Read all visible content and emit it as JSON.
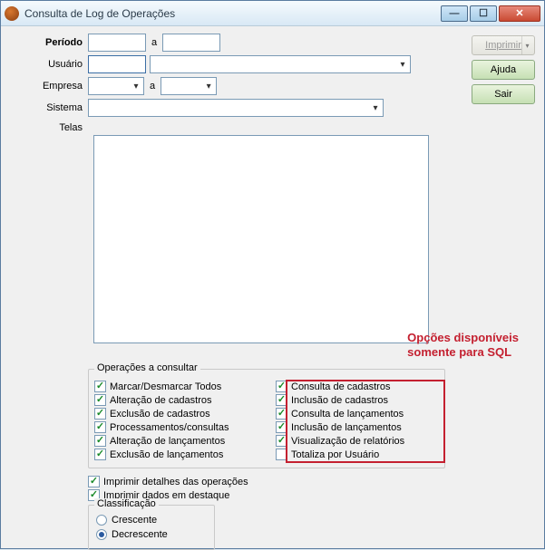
{
  "window": {
    "title": "Consulta de Log de Operações"
  },
  "form": {
    "periodo_label": "Período",
    "periodo_a": "a",
    "usuario_label": "Usuário",
    "empresa_label": "Empresa",
    "empresa_a": "a",
    "sistema_label": "Sistema",
    "telas_label": "Telas"
  },
  "annotation": {
    "line1": "Opções disponíveis",
    "line2": "somente para SQL"
  },
  "ops": {
    "legend": "Operações a consultar",
    "left": [
      "Marcar/Desmarcar Todos",
      "Alteração de cadastros",
      "Exclusão de cadastros",
      "Processamentos/consultas",
      "Alteração de lançamentos",
      "Exclusão de lançamentos"
    ],
    "right": [
      "Consulta de cadastros",
      "Inclusão de cadastros",
      "Consulta de lançamentos",
      "Inclusão de lançamentos",
      "Visualização de relatórios",
      "Totaliza por Usuário"
    ]
  },
  "extras": {
    "a": "Imprimir detalhes das operações",
    "b": "Imprimir dados em destaque"
  },
  "classif": {
    "legend": "Classificação",
    "cresc": "Crescente",
    "decresc": "Decrescente"
  },
  "buttons": {
    "imprimir": "Imprimir",
    "ajuda": "Ajuda",
    "sair": "Sair"
  }
}
